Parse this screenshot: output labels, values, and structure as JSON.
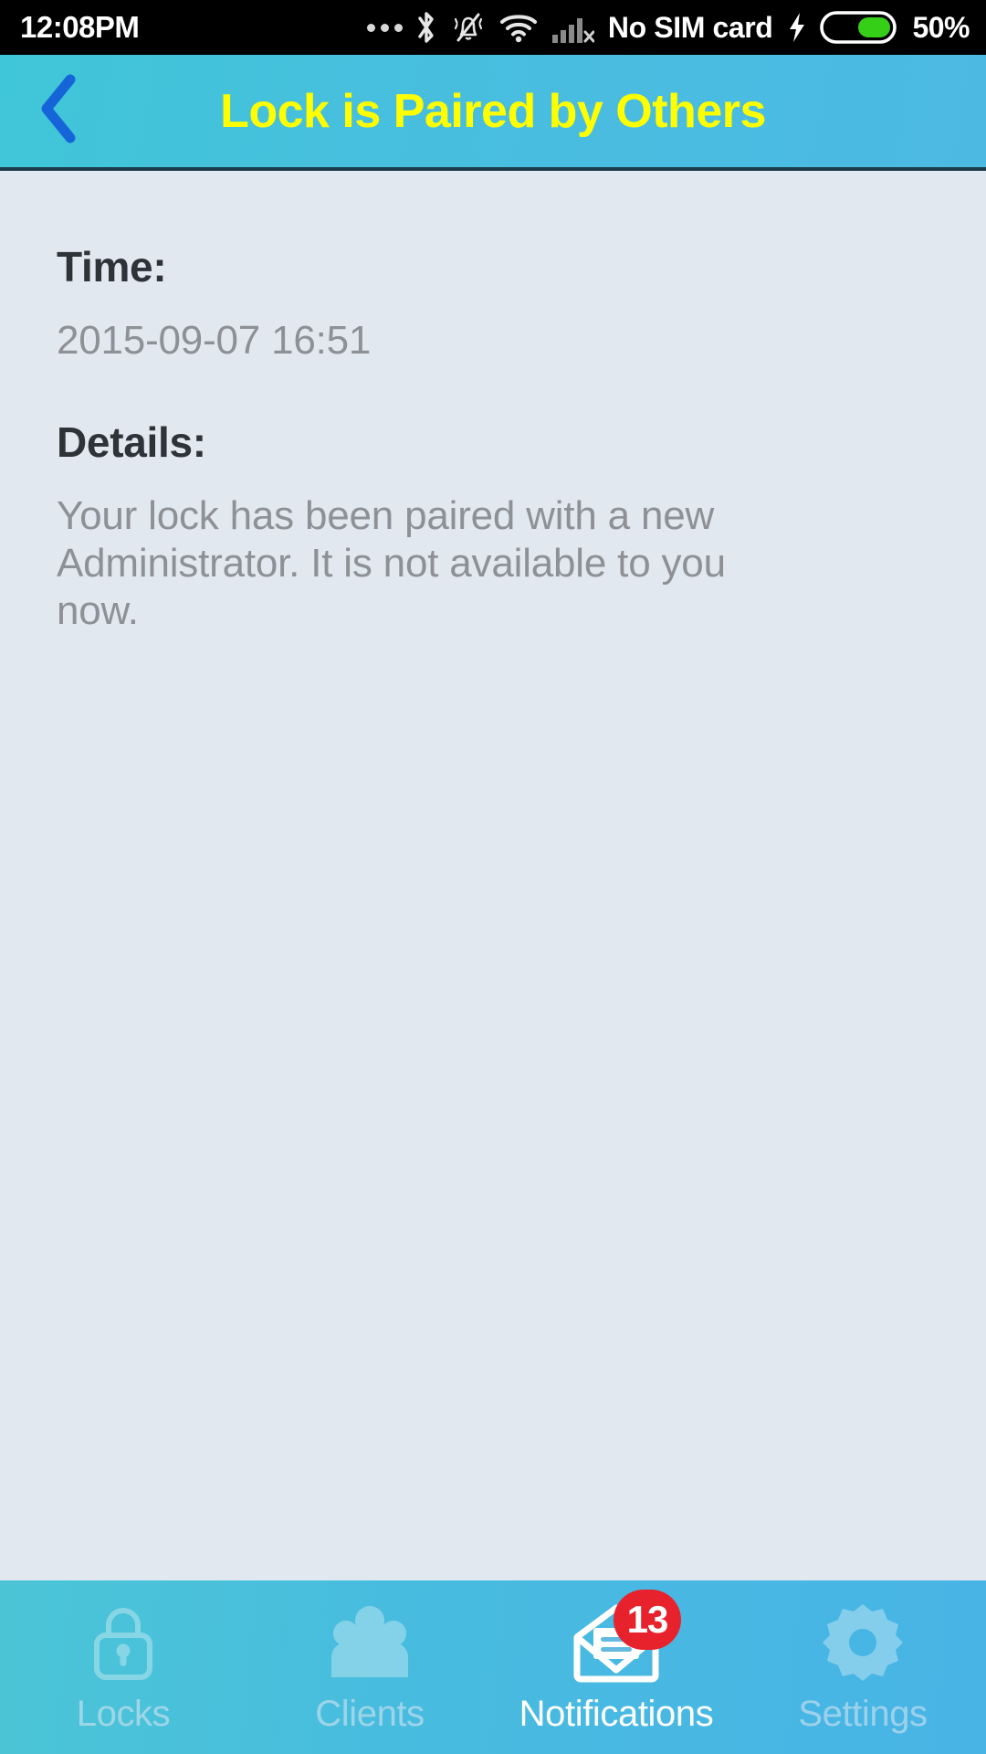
{
  "status_bar": {
    "clock": "12:08PM",
    "sim_text": "No SIM card",
    "battery_percent": "50%",
    "icons": [
      "more-dots-icon",
      "bluetooth-icon",
      "vibrate-muted-bell-icon",
      "wifi-icon",
      "signal-bars-no-service-icon",
      "charging-bolt-icon",
      "battery-icon"
    ]
  },
  "header": {
    "back_icon": "chevron-left-icon",
    "title": "Lock is Paired by Others",
    "title_color": "#ffff00",
    "background_color": "#48bedf"
  },
  "content": {
    "time_label": "Time:",
    "time_value": "2015-09-07 16:51",
    "details_label": "Details:",
    "details_value": "Your lock has been paired with a new Administrator. It is not available to you now.",
    "background_color": "#e2e8f0"
  },
  "tab_bar": {
    "background_color": "#48bcdf",
    "active_index": 2,
    "tabs": [
      {
        "label": "Locks",
        "icon": "padlock-icon",
        "active": false,
        "badge": null
      },
      {
        "label": "Clients",
        "icon": "people-group-icon",
        "active": false,
        "badge": null
      },
      {
        "label": "Notifications",
        "icon": "open-envelope-icon",
        "active": true,
        "badge": "13"
      },
      {
        "label": "Settings",
        "icon": "gear-icon",
        "active": false,
        "badge": null
      }
    ],
    "badge_color": "#e8222c"
  }
}
